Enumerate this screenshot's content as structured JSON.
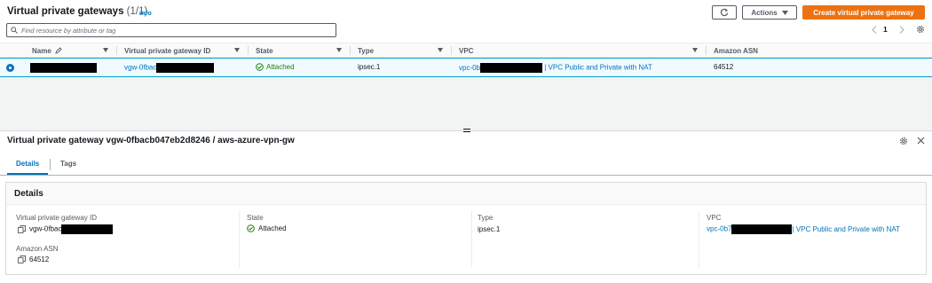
{
  "header": {
    "title": "Virtual private gateways",
    "count": "(1/1)",
    "info": "info",
    "actions_label": "Actions",
    "create_label": "Create virtual private gateway"
  },
  "search": {
    "placeholder": "Find resource by attribute or tag"
  },
  "pagination": {
    "page": "1"
  },
  "table": {
    "columns": [
      "Name",
      "Virtual private gateway ID",
      "State",
      "Type",
      "VPC",
      "Amazon ASN"
    ],
    "rows": [
      {
        "name": "",
        "gateway_id_prefix": "vgw-0fbac",
        "state": "Attached",
        "type": "ipsec.1",
        "vpc_prefix": "vpc-0b",
        "vpc_suffix": " | VPC Public and Private with NAT",
        "asn": "64512"
      }
    ]
  },
  "detail": {
    "title": "Virtual private gateway vgw-0fbacb047eb2d8246 / aws-azure-vpn-gw",
    "tabs": [
      "Details",
      "Tags"
    ],
    "card_title": "Details",
    "fields": {
      "gateway_id_label": "Virtual private gateway ID",
      "gateway_id_prefix": "vgw-0fbac",
      "state_label": "State",
      "state_value": "Attached",
      "type_label": "Type",
      "type_value": "ipsec.1",
      "vpc_label": "VPC",
      "vpc_prefix": "vpc-0b7",
      "vpc_suffix": " | VPC Public and Private with NAT",
      "asn_label": "Amazon ASN",
      "asn_value": "64512"
    }
  },
  "colors": {
    "link": "#0073bb",
    "primary_button": "#ec7211",
    "success": "#1d8102",
    "selected_row": "#f1faff"
  },
  "icons": [
    "refresh-icon",
    "caret-down-icon",
    "search-icon",
    "chevron-left-icon",
    "chevron-right-icon",
    "settings-gear-icon",
    "edit-pencil-icon",
    "sort-caret-icon",
    "check-circle-icon",
    "copy-icon",
    "close-icon",
    "drag-handle-icon"
  ]
}
